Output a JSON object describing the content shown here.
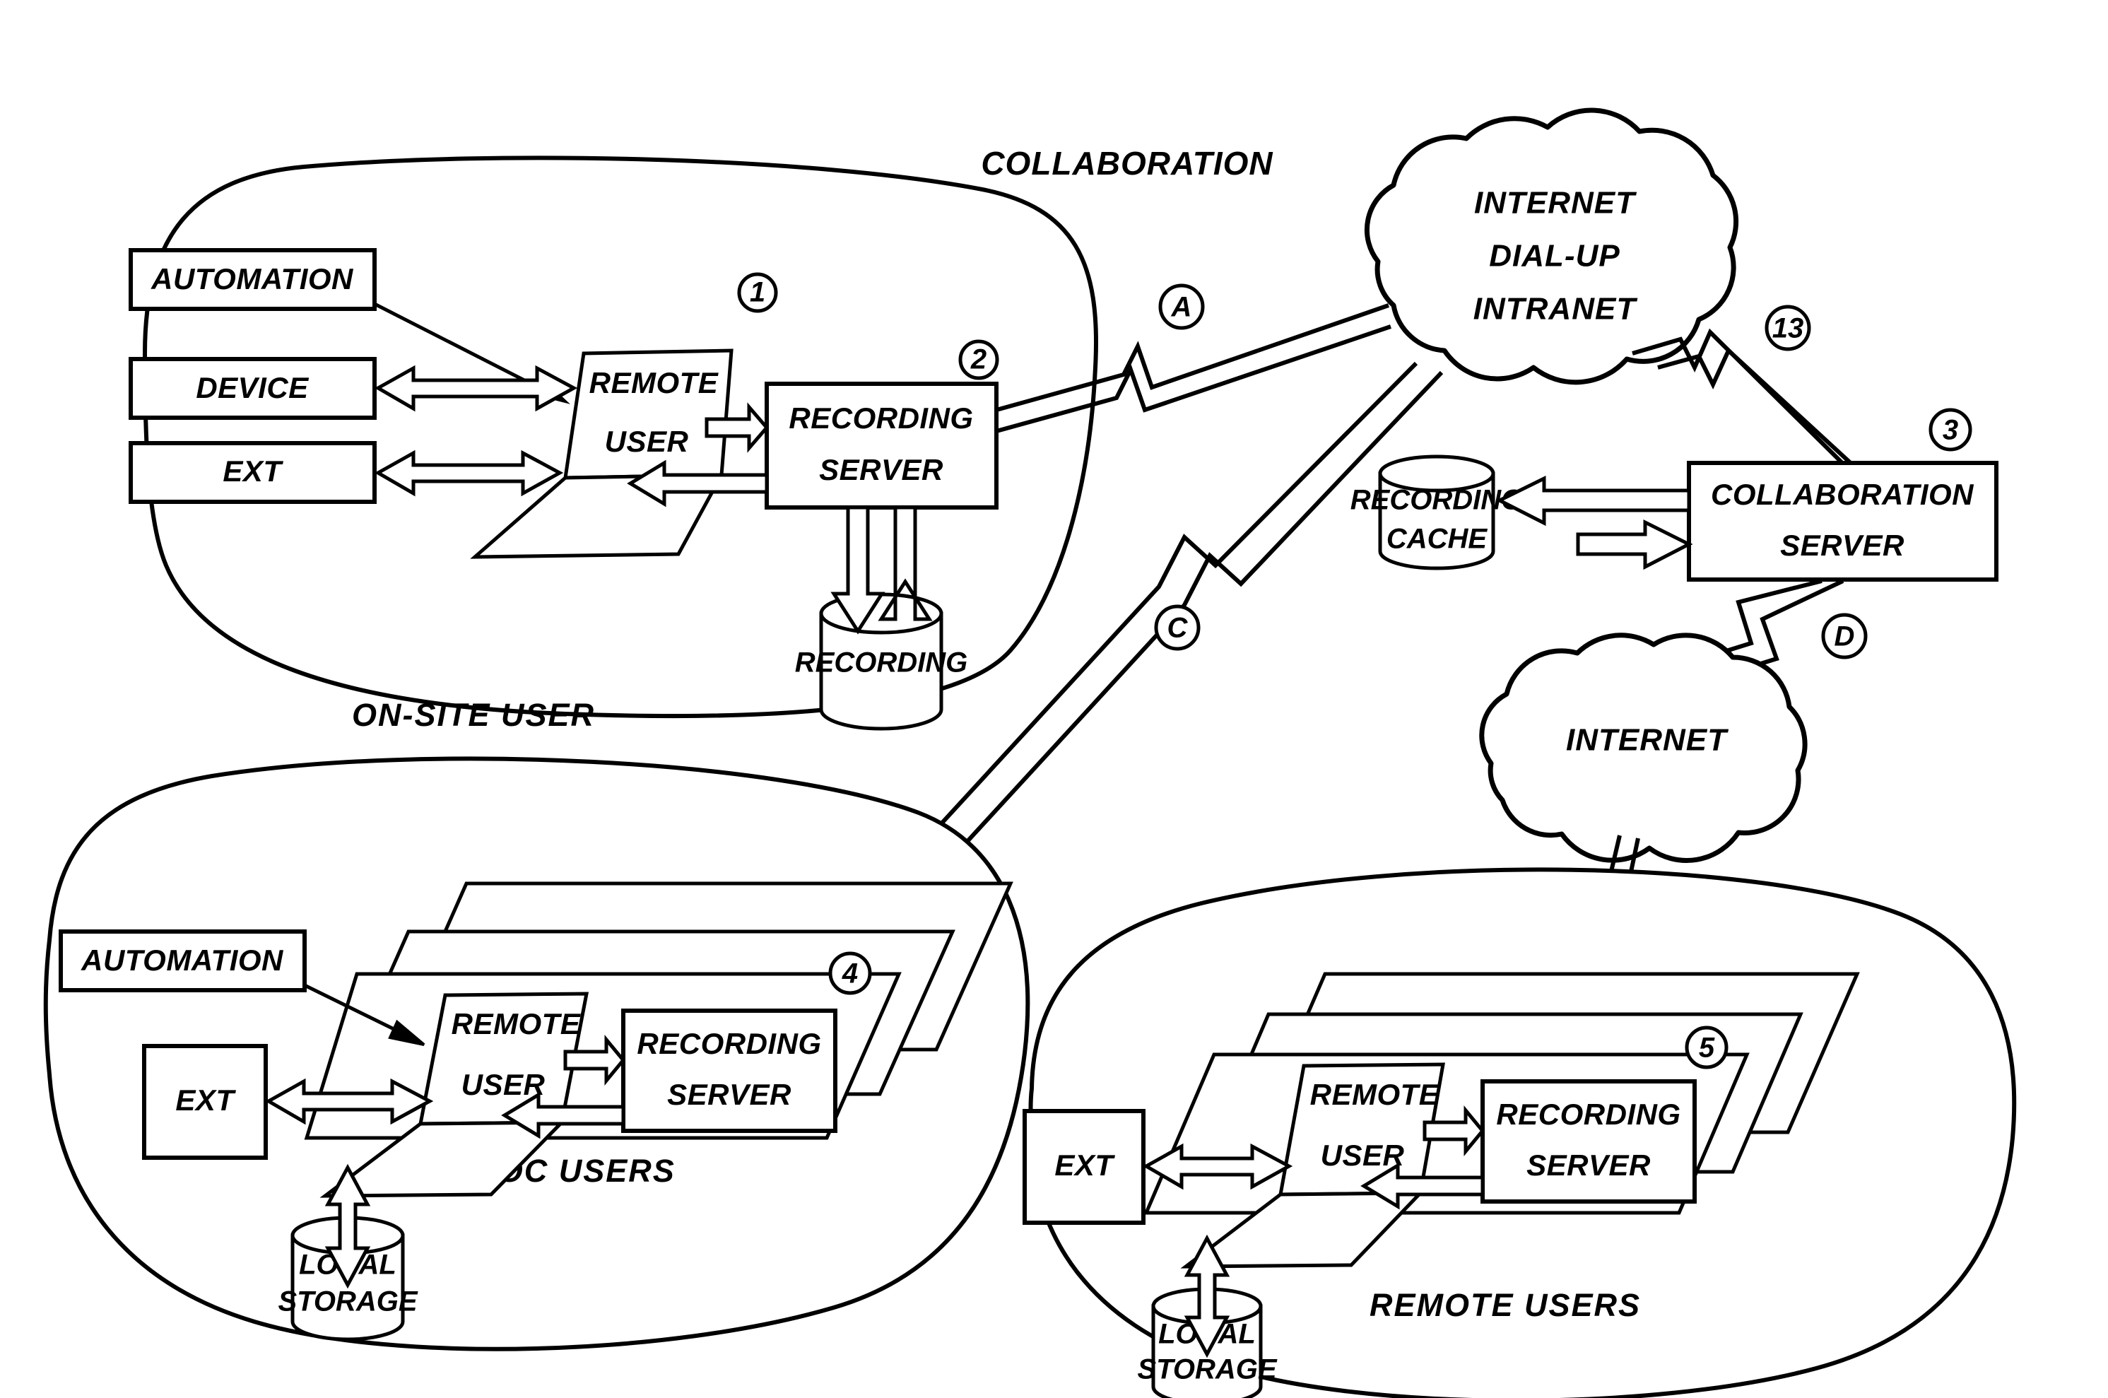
{
  "title": "COLLABORATION",
  "regions": {
    "onsite": {
      "label": "ON-SITE USER",
      "marks": [
        "1",
        "2"
      ]
    },
    "adhoc": {
      "label": "AD-HOC USERS",
      "marks": [
        "4"
      ]
    },
    "remote": {
      "label": "REMOTE USERS",
      "marks": [
        "5"
      ]
    }
  },
  "clouds": [
    {
      "id": "cloud-top",
      "lines": [
        "INTERNET",
        "DIAL-UP",
        "INTRANET"
      ]
    },
    {
      "id": "cloud-bottom",
      "lines": [
        "INTERNET"
      ]
    }
  ],
  "onsite_nodes": {
    "automation": "AUTOMATION",
    "device": "DEVICE",
    "ext": "EXT",
    "remote_user_l1": "REMOTE",
    "remote_user_l2": "USER",
    "recording_server_l1": "RECORDING",
    "recording_server_l2": "SERVER",
    "recording_store": "RECORDING"
  },
  "adhoc_nodes": {
    "automation": "AUTOMATION",
    "ext": "EXT",
    "remote_user_l1": "REMOTE",
    "remote_user_l2": "USER",
    "recording_server_l1": "RECORDING",
    "recording_server_l2": "SERVER",
    "local_storage_l1": "LOCAL",
    "local_storage_l2": "STORAGE"
  },
  "remote_nodes": {
    "ext": "EXT",
    "remote_user_l1": "REMOTE",
    "remote_user_l2": "USER",
    "recording_server_l1": "RECORDING",
    "recording_server_l2": "SERVER",
    "local_storage_l1": "LOCAL",
    "local_storage_l2": "STORAGE"
  },
  "collab_nodes": {
    "recording_cache_l1": "RECORDING",
    "recording_cache_l2": "CACHE",
    "collaboration_server_l1": "COLLABORATION",
    "collaboration_server_l2": "SERVER"
  },
  "reference_marks": {
    "m1": "1",
    "m2": "2",
    "m3": "3",
    "m4": "4",
    "m5": "5",
    "m13": "13",
    "mA": "A",
    "mC": "C",
    "mD": "D"
  },
  "colors": {
    "ink": "#000000",
    "paper": "#ffffff"
  }
}
